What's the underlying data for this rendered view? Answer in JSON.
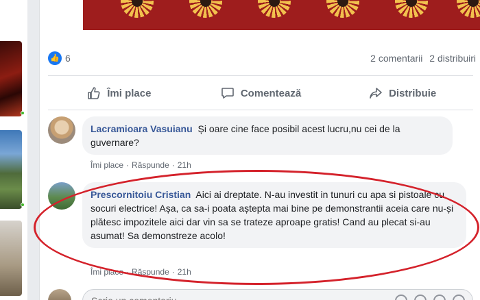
{
  "post": {
    "stats": {
      "reactions_count": "6",
      "comments": "2 comentarii",
      "shares": "2 distribuiri"
    },
    "actions": {
      "like": "Îmi place",
      "comment": "Comentează",
      "share": "Distribuie"
    }
  },
  "comments": [
    {
      "author": "Lacramioara Vasuianu",
      "text": "Și oare cine face posibil acest lucru,nu cei de la guvernare?",
      "like": "Îmi place",
      "reply": "Răspunde",
      "time": "21h"
    },
    {
      "author": "Prescornitoiu Cristian",
      "text": "Aici ai dreptate. N-au investit in tunuri cu apa si pistoale cu socuri electrice! Așa, ca sa-i poata aștepta mai bine pe demonstrantii aceia care nu-și plătesc impozitele aici dar vin sa se trateze aproape gratis! Cand au plecat si-au asumat! Sa demonstreze acolo!",
      "like": "Îmi place",
      "reply": "Răspunde",
      "time": "21h"
    }
  ],
  "reply_box": {
    "placeholder": "Scrie un comentariu..."
  },
  "colors": {
    "brand_blue": "#1877f2",
    "author_link": "#385898",
    "highlight_ellipse": "#d4222b"
  }
}
